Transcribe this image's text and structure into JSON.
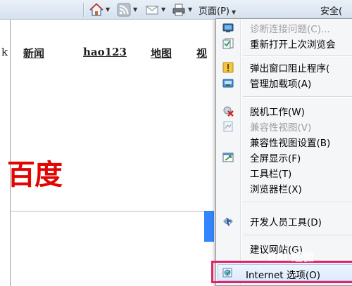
{
  "command_bar": {
    "page_menu": "页面(P)",
    "safety_menu": "安全("
  },
  "page": {
    "nav_links": [
      "新闻",
      "hao123",
      "地图",
      "视"
    ],
    "left_fragment": "k",
    "logo_text": "百度"
  },
  "tools_menu": {
    "items": [
      {
        "label": "诊断连接问题(C)...",
        "icon": "network-diagnose-icon",
        "disabled": true
      },
      {
        "label": "重新打开上次浏览会",
        "icon": "reopen-session-icon",
        "disabled": false
      },
      {
        "label": "弹出窗口阻止程序(",
        "icon": "popup-blocker-icon",
        "disabled": false
      },
      {
        "label": "管理加载项(A)",
        "icon": "manage-addons-icon",
        "disabled": false
      },
      {
        "label": "脱机工作(W)",
        "icon": "work-offline-icon",
        "disabled": false
      },
      {
        "label": "兼容性视图(V)",
        "icon": "compat-view-icon",
        "disabled": true
      },
      {
        "label": "兼容性视图设置(B)",
        "icon": "",
        "disabled": false
      },
      {
        "label": "全屏显示(F)",
        "icon": "fullscreen-icon",
        "disabled": false
      },
      {
        "label": "工具栏(T)",
        "icon": "",
        "disabled": false
      },
      {
        "label": "浏览器栏(X)",
        "icon": "",
        "disabled": false
      },
      {
        "label": "开发人员工具(D)",
        "icon": "developer-tools-icon",
        "disabled": false
      },
      {
        "label": "建议网站(G)",
        "icon": "",
        "disabled": false
      },
      {
        "label": "Internet 选项(O)",
        "icon": "internet-options-icon",
        "disabled": false
      }
    ]
  },
  "watermark": "Bai 经验"
}
